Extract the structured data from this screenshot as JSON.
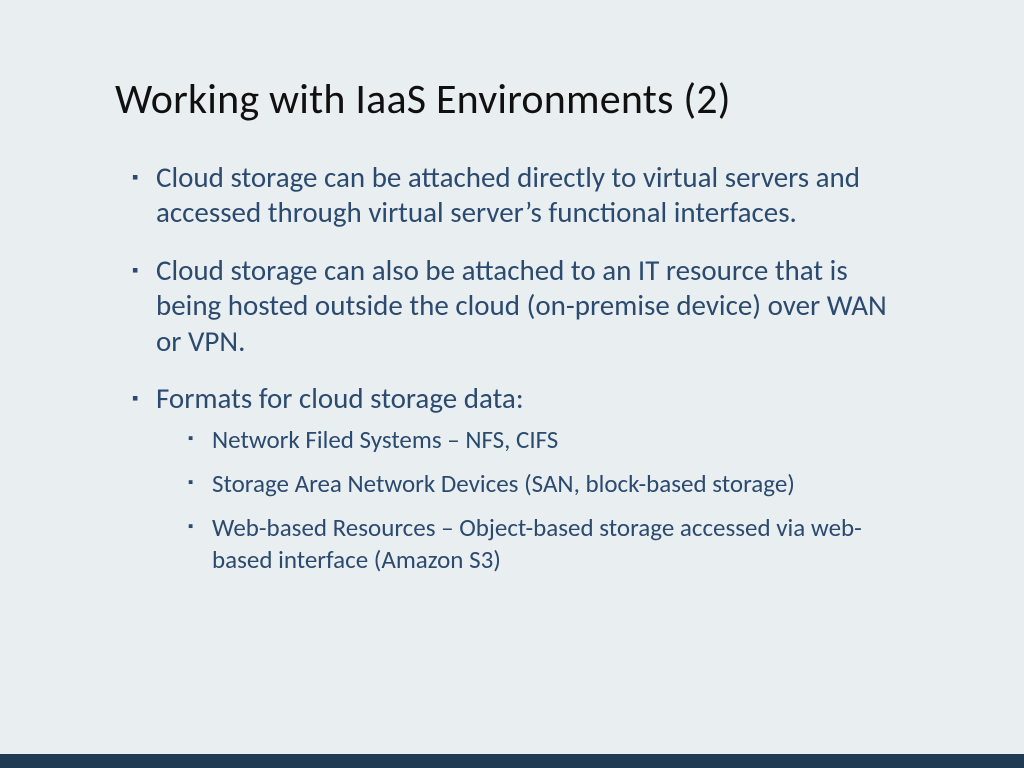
{
  "title": "Working with IaaS Environments (2)",
  "bullets": [
    {
      "text": "Cloud storage can be attached directly to virtual servers and accessed through virtual server’s functional interfaces."
    },
    {
      "text": "Cloud storage can also be attached to an IT resource that is being hosted outside the cloud (on-premise device) over WAN or VPN."
    },
    {
      "text": "Formats for cloud storage data:",
      "sub": [
        "Network Filed Systems – NFS, CIFS",
        "Storage Area Network Devices (SAN, block-based storage)",
        "Web-based Resources – Object-based storage accessed via web-based interface (Amazon S3)"
      ]
    }
  ]
}
